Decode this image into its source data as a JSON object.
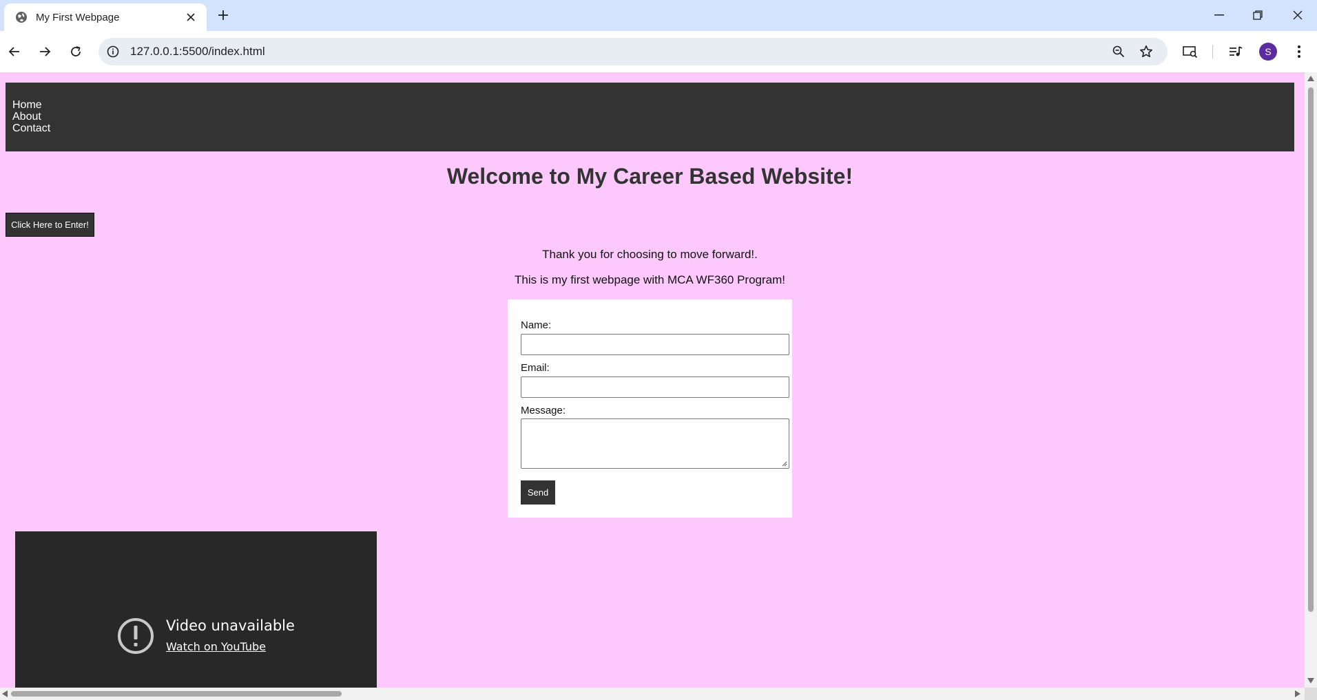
{
  "browser": {
    "tab_title": "My First Webpage",
    "url": "127.0.0.1:5500/index.html",
    "profile_initial": "S",
    "icons": {
      "favicon": "globe-icon",
      "tab_close": "close-icon",
      "new_tab": "plus-icon",
      "back": "arrow-left-icon",
      "forward": "arrow-right-icon",
      "reload": "reload-icon",
      "site_info": "info-icon",
      "zoom": "zoom-out-icon",
      "bookmark": "star-icon",
      "cast": "cast-search-icon",
      "media": "media-controls-icon",
      "menu": "kebab-menu-icon"
    },
    "colors": {
      "tabstrip": "#d3e3fd",
      "omnibox": "#e8ecf3",
      "avatar": "#5b2ca0"
    }
  },
  "page": {
    "background": "#fdc9fd",
    "nav": {
      "items": [
        "Home",
        "About",
        "Contact"
      ],
      "background": "#333333"
    },
    "heading": "Welcome to My Career Based Website!",
    "enter_button": "Click Here to Enter!",
    "paragraphs": [
      "Thank you for choosing to move forward!.",
      "This is my first webpage with MCA WF360 Program!"
    ],
    "form": {
      "name_label": "Name:",
      "name_value": "",
      "email_label": "Email:",
      "email_value": "",
      "message_label": "Message:",
      "message_value": "",
      "send_button": "Send"
    },
    "video": {
      "title": "Video unavailable",
      "link": "Watch on YouTube",
      "icon": "exclamation-circle-icon"
    }
  }
}
